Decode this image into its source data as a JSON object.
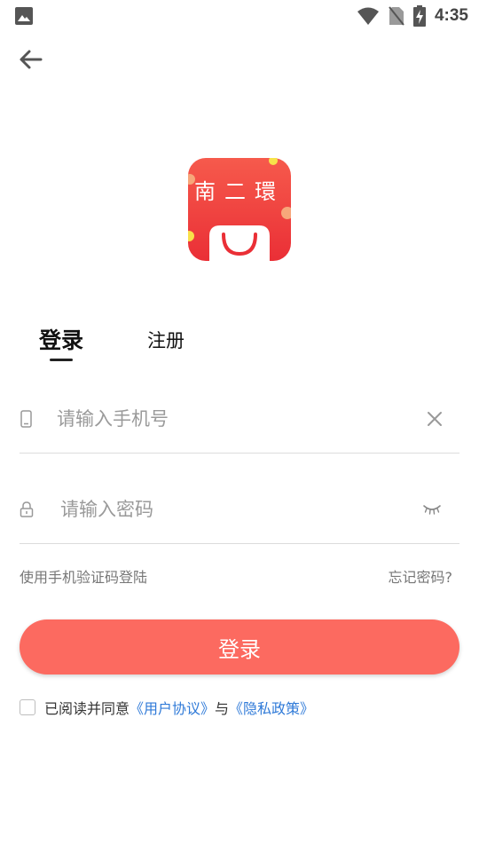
{
  "status_bar": {
    "time": "4:35"
  },
  "logo": {
    "text": "南二環"
  },
  "tabs": {
    "login": "登录",
    "register": "注册"
  },
  "phone_field": {
    "placeholder": "请输入手机号",
    "value": ""
  },
  "password_field": {
    "placeholder": "请输入密码",
    "value": ""
  },
  "links": {
    "sms_login": "使用手机验证码登陆",
    "forgot_password": "忘记密码?"
  },
  "login_button": {
    "label": "登录"
  },
  "agreement": {
    "prefix": "已阅读并同意",
    "user_agreement": "《用户协议》",
    "conjunction": "与",
    "privacy_policy": "《隐私政策》"
  },
  "colors": {
    "accent": "#fc6a60",
    "link": "#2f7ad8",
    "logo_red": "#ef3f3f"
  }
}
